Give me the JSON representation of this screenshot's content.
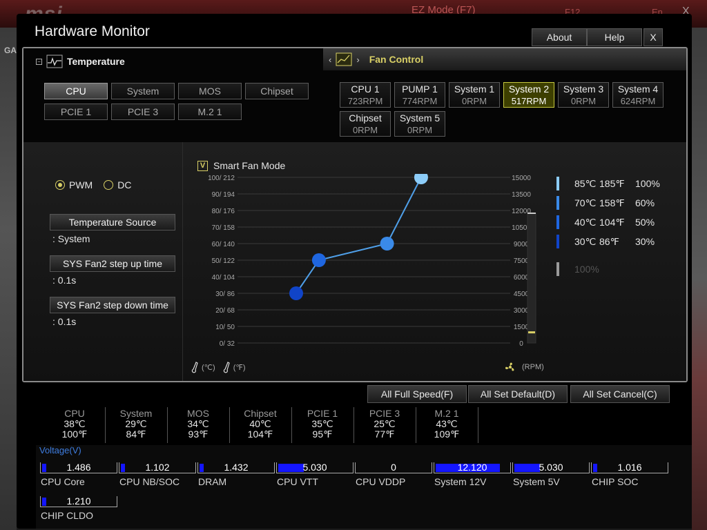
{
  "background": {
    "logo_text": "msi",
    "ez_mode": "EZ Mode (F7)",
    "f12": "F12",
    "lang": "En",
    "close": "X",
    "game_tab": "GA"
  },
  "dialog": {
    "title": "Hardware Monitor",
    "about": "About",
    "help": "Help",
    "close": "X"
  },
  "tabs": {
    "temperature": "Temperature",
    "fan_control": "Fan Control"
  },
  "sensor_sources": [
    "CPU",
    "System",
    "MOS",
    "Chipset",
    "PCIE 1",
    "PCIE 3",
    "M.2 1"
  ],
  "selected_source": "CPU",
  "fans": [
    {
      "name": "CPU 1",
      "rpm": "723RPM"
    },
    {
      "name": "PUMP 1",
      "rpm": "774RPM"
    },
    {
      "name": "System 1",
      "rpm": "0RPM"
    },
    {
      "name": "System 2",
      "rpm": "517RPM"
    },
    {
      "name": "System 3",
      "rpm": "0RPM"
    },
    {
      "name": "System 4",
      "rpm": "624RPM"
    },
    {
      "name": "Chipset",
      "rpm": "0RPM"
    },
    {
      "name": "System 5",
      "rpm": "0RPM"
    }
  ],
  "selected_fan": "System 2",
  "fan_mode": {
    "pwm": "PWM",
    "dc": "DC",
    "selected": "PWM"
  },
  "settings": {
    "temp_source_label": "Temperature Source",
    "temp_source_value": ": System",
    "step_up_label": "SYS Fan2 step up time",
    "step_up_value": ": 0.1s",
    "step_down_label": "SYS Fan2 step down time",
    "step_down_value": ": 0.1s"
  },
  "smart_fan": {
    "label": "Smart Fan Mode",
    "checked": true,
    "check_mark": "V"
  },
  "chart_data": {
    "type": "line",
    "left_axis_ticks": [
      "100/ 212",
      "90/ 194",
      "80/ 176",
      "70/ 158",
      "60/ 140",
      "50/ 122",
      "40/ 104",
      "30/  86",
      "20/  68",
      "10/  50",
      "0/  32"
    ],
    "right_axis_ticks": [
      "15000",
      "13500",
      "12000",
      "10500",
      "9000",
      "7500",
      "6000",
      "4500",
      "3000",
      "1500",
      "0"
    ],
    "x_unit_c": "(℃)",
    "x_unit_f": "(℉)",
    "rpm_unit": "(RPM)",
    "xlim": [
      0,
      100
    ],
    "ylim": [
      0,
      100
    ],
    "points": [
      {
        "temp_c": 30,
        "percent": 30,
        "color": "#1044c8"
      },
      {
        "temp_c": 40,
        "percent": 50,
        "color": "#1f66e0"
      },
      {
        "temp_c": 70,
        "percent": 60,
        "color": "#3a8ae8"
      },
      {
        "temp_c": 85,
        "percent": 100,
        "color": "#8cccf8"
      }
    ],
    "current_rpm_fraction": 0.03
  },
  "legend": [
    {
      "c": "85℃",
      "f": "185℉",
      "pct": "100%",
      "color": "#8cccf8"
    },
    {
      "c": "70℃",
      "f": "158℉",
      "pct": "60%",
      "color": "#3a8ae8"
    },
    {
      "c": "40℃",
      "f": "104℉",
      "pct": "50%",
      "color": "#1f66e0"
    },
    {
      "c": "30℃",
      "f": "86℉",
      "pct": "30%",
      "color": "#1044c8"
    }
  ],
  "legend_extra": "100%",
  "actions": {
    "full_speed": "All Full Speed(F)",
    "set_default": "All Set Default(D)",
    "set_cancel": "All Set Cancel(C)"
  },
  "temps": [
    {
      "name": "CPU",
      "c": "38℃",
      "f": "100℉"
    },
    {
      "name": "System",
      "c": "29℃",
      "f": "84℉"
    },
    {
      "name": "MOS",
      "c": "34℃",
      "f": "93℉"
    },
    {
      "name": "Chipset",
      "c": "40℃",
      "f": "104℉"
    },
    {
      "name": "PCIE 1",
      "c": "35℃",
      "f": "95℉"
    },
    {
      "name": "PCIE 3",
      "c": "25℃",
      "f": "77℉"
    },
    {
      "name": "M.2 1",
      "c": "43℃",
      "f": "109℉"
    }
  ],
  "voltage": {
    "title": "Voltage(V)",
    "items": [
      {
        "label": "CPU Core",
        "value": "1.486",
        "level": 0.06
      },
      {
        "label": "CPU NB/SOC",
        "value": "1.102",
        "level": 0.05
      },
      {
        "label": "DRAM",
        "value": "1.432",
        "level": 0.06
      },
      {
        "label": "CPU VTT",
        "value": "5.030",
        "level": 0.35
      },
      {
        "label": "CPU VDDP",
        "value": "0",
        "level": 0
      },
      {
        "label": "System 12V",
        "value": "12.120",
        "level": 0.88
      },
      {
        "label": "System 5V",
        "value": "5.030",
        "level": 0.35
      },
      {
        "label": "CHIP SOC",
        "value": "1.016",
        "level": 0.05
      },
      {
        "label": "CHIP CLDO",
        "value": "1.210",
        "level": 0.05
      }
    ]
  }
}
